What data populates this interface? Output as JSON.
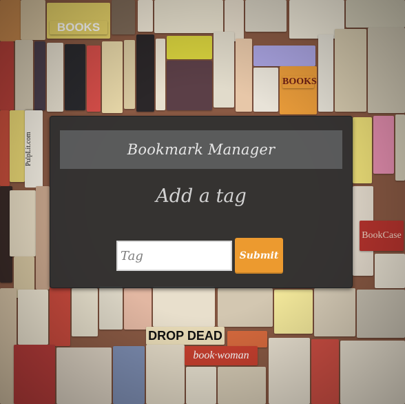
{
  "app": {
    "title": "Bookmark Manager"
  },
  "main": {
    "heading": "Add a tag"
  },
  "form": {
    "tag_placeholder": "Tag",
    "tag_value": "",
    "submit_label": "Submit"
  },
  "background": {
    "text_items": {
      "books_sign": "BOOKS",
      "pulp_lit": "PulpLit.com",
      "books_poster": "BOOKS",
      "drop_dead": "DROP DEAD",
      "book_woman": "book·woman",
      "bookcase": "BookCase"
    }
  },
  "colors": {
    "panel": "#2c3032",
    "submit": "#ec9a2f",
    "input": "#ffffff"
  }
}
